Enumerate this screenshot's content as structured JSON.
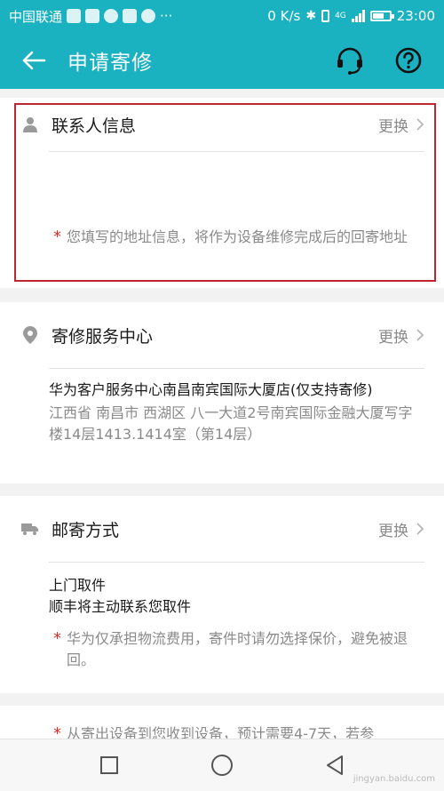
{
  "status_bar": {
    "carrier": "中国联通",
    "more": "···",
    "net_speed": "0 K/s",
    "network": "4G",
    "time": "23:00",
    "battery_level_percent": 70
  },
  "app_bar": {
    "title": "申请寄修",
    "back_icon": "arrow-left-icon",
    "support_icon": "headset-icon",
    "help_icon": "question-circle-icon"
  },
  "contact": {
    "title": "联系人信息",
    "change_label": "更换",
    "note": "您填写的地址信息，将作为设备维修完成后的回寄地址"
  },
  "service_center": {
    "title": "寄修服务中心",
    "change_label": "更换",
    "name": "华为客户服务中心南昌南宾国际大厦店(仅支持寄修)",
    "address": "江西省 南昌市 西湖区 八一大道2号南宾国际金融大厦写字楼14层1413.1414室（第14层）"
  },
  "shipping": {
    "title": "邮寄方式",
    "change_label": "更换",
    "method": "上门取件",
    "detail": "顺丰将主动联系您取件",
    "note": "华为仅承担物流费用，寄件时请勿选择保价，避免被退回。"
  },
  "footer_note": "从寄出设备到您收到设备，预计需要4-7天，若参",
  "watermark": "jingyan.baidu.com",
  "colors": {
    "primary": "#1ab1c0",
    "highlight_border": "#c0262d",
    "star": "#d6312b"
  }
}
